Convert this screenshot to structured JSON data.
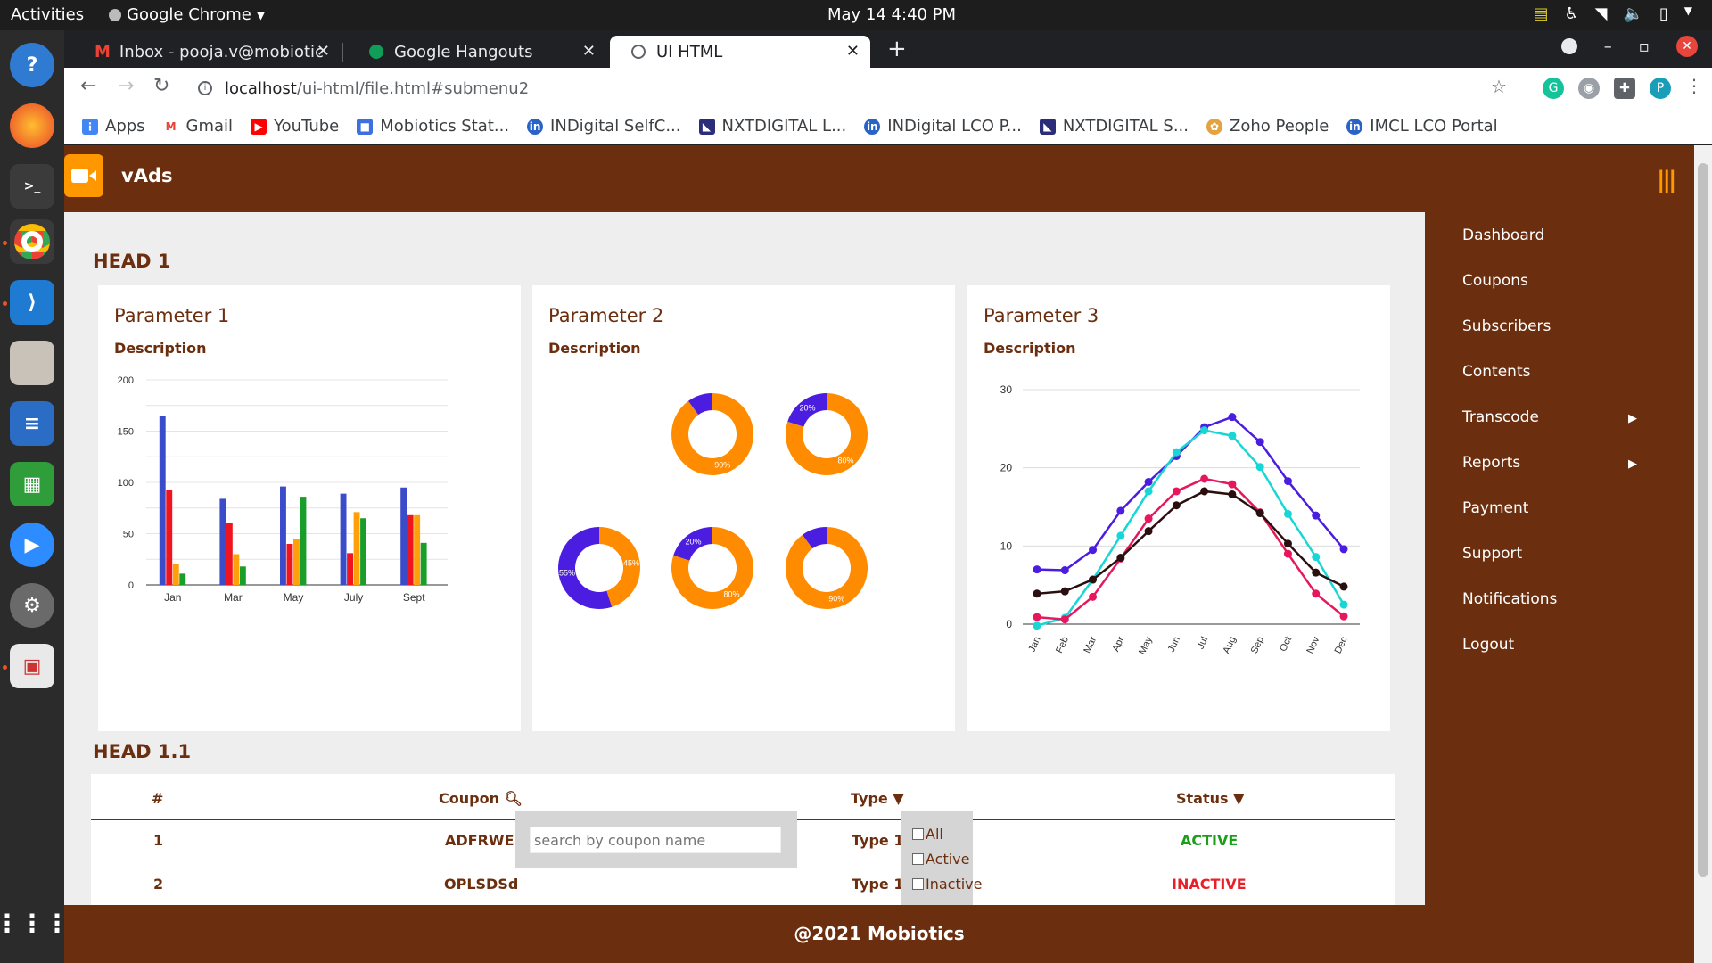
{
  "system": {
    "activities": "Activities",
    "app_name": "Google Chrome",
    "clock": "May 14  4:40 PM"
  },
  "browser": {
    "tabs": [
      {
        "label": "Inbox - pooja.v@mobiotic",
        "icon": "gmail-icon"
      },
      {
        "label": "Google Hangouts",
        "icon": "hangouts-icon"
      },
      {
        "label": "UI HTML",
        "icon": "globe-icon"
      }
    ],
    "url_host": "localhost",
    "url_path": "/ui-html/file.html#submenu2",
    "profile_initial": "P",
    "bookmarks": [
      "Apps",
      "Gmail",
      "YouTube",
      "Mobiotics Stat...",
      "INDigital SelfC...",
      "NXTDIGITAL L...",
      "INDigital LCO P...",
      "NXTDIGITAL S...",
      "Zoho People",
      "IMCL LCO Portal"
    ]
  },
  "app": {
    "brand": "vAds",
    "menu": [
      {
        "label": "Dashboard",
        "submenu": false
      },
      {
        "label": "Coupons",
        "submenu": false
      },
      {
        "label": "Subscribers",
        "submenu": false
      },
      {
        "label": "Contents",
        "submenu": false
      },
      {
        "label": "Transcode",
        "submenu": true
      },
      {
        "label": "Reports",
        "submenu": true
      },
      {
        "label": "Payment",
        "submenu": false
      },
      {
        "label": "Support",
        "submenu": false
      },
      {
        "label": "Notifications",
        "submenu": false
      },
      {
        "label": "Logout",
        "submenu": false
      }
    ],
    "head1": "HEAD 1",
    "head11": "HEAD 1.1",
    "cards": [
      {
        "title": "Parameter 1",
        "description": "Description"
      },
      {
        "title": "Parameter 2",
        "description": "Description"
      },
      {
        "title": "Parameter 3",
        "description": "Description"
      }
    ],
    "table": {
      "headers": [
        "#",
        "Coupon",
        "Type",
        "Status"
      ],
      "rows": [
        {
          "num": "1",
          "coupon": "ADFRWE",
          "type": "Type 1",
          "status": "ACTIVE"
        },
        {
          "num": "2",
          "coupon": "OPLSDSd",
          "type": "Type 1",
          "status": "INACTIVE"
        }
      ],
      "search_placeholder": "search by coupon name",
      "filter_options": [
        "All",
        "Active",
        "Inactive"
      ]
    },
    "footer": "@2021 Mobiotics",
    "colors": {
      "brand": "#6b2e0f",
      "accent": "#ff9800",
      "active": "#1b9e1b",
      "inactive": "#e8202a"
    }
  },
  "chart_data": [
    {
      "type": "bar",
      "categories": [
        "Jan",
        "Mar",
        "May",
        "July",
        "Sept"
      ],
      "ylim": [
        0,
        200
      ],
      "yticks": [
        0,
        50,
        100,
        150,
        200
      ],
      "series": [
        {
          "color": "#3b4cca",
          "values": [
            165,
            84,
            96,
            89,
            95
          ]
        },
        {
          "color": "#f0141e",
          "values": [
            93,
            60,
            40,
            31,
            68
          ]
        },
        {
          "color": "#ff9f0a",
          "values": [
            20,
            30,
            45,
            71,
            68
          ]
        },
        {
          "color": "#1a9e2a",
          "values": [
            11,
            18,
            86,
            65,
            41
          ]
        }
      ]
    },
    {
      "type": "pie",
      "donuts": [
        {
          "slices": [
            {
              "value": 90,
              "color": "#ff8c00",
              "label": "90%"
            },
            {
              "value": 10,
              "color": "#4b1de0",
              "label": ""
            }
          ]
        },
        {
          "slices": [
            {
              "value": 80,
              "color": "#ff8c00",
              "label": "80%"
            },
            {
              "value": 20,
              "color": "#4b1de0",
              "label": "20%"
            }
          ]
        },
        {
          "slices": [
            {
              "value": 45,
              "color": "#ff8c00",
              "label": "45%"
            },
            {
              "value": 55,
              "color": "#4b1de0",
              "label": "55%"
            }
          ]
        },
        {
          "slices": [
            {
              "value": 80,
              "color": "#ff8c00",
              "label": "80%"
            },
            {
              "value": 20,
              "color": "#4b1de0",
              "label": "20%"
            }
          ]
        },
        {
          "slices": [
            {
              "value": 90,
              "color": "#ff8c00",
              "label": "90%"
            },
            {
              "value": 10,
              "color": "#4b1de0",
              "label": ""
            }
          ]
        }
      ]
    },
    {
      "type": "line",
      "x": [
        "Jan",
        "Feb",
        "Mar",
        "Apr",
        "May",
        "Jun",
        "Jul",
        "Aug",
        "Sep",
        "Oct",
        "Nov",
        "Dec"
      ],
      "ylim": [
        0,
        30
      ],
      "yticks": [
        0,
        10,
        20,
        30
      ],
      "series": [
        {
          "color": "#4b1de0",
          "values": [
            7,
            6.9,
            9.5,
            14.5,
            18.2,
            21.5,
            25.2,
            26.5,
            23.3,
            18.3,
            13.9,
            9.6
          ]
        },
        {
          "color": "#19d6d6",
          "values": [
            -0.2,
            0.8,
            5.7,
            11.3,
            17,
            22,
            24.8,
            24.1,
            20.1,
            14.1,
            8.6,
            2.5
          ]
        },
        {
          "color": "#e8175d",
          "values": [
            0.9,
            0.6,
            3.5,
            8.4,
            13.5,
            17,
            18.6,
            17.9,
            14.3,
            9,
            3.9,
            1
          ]
        },
        {
          "color": "#2a0f0f",
          "values": [
            3.9,
            4.2,
            5.7,
            8.5,
            11.9,
            15.2,
            17,
            16.6,
            14.2,
            10.3,
            6.6,
            4.8
          ]
        }
      ]
    }
  ]
}
